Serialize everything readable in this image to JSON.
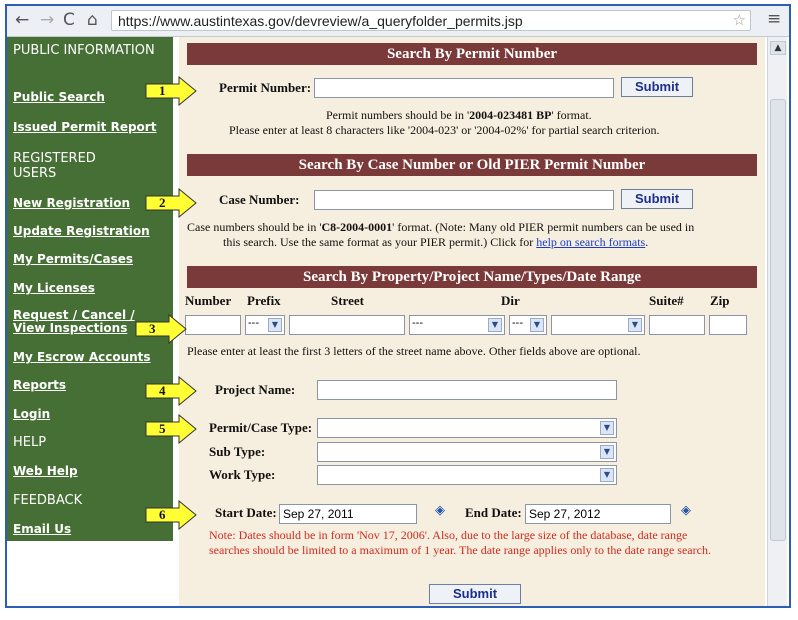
{
  "browser": {
    "url": "https://www.austintexas.gov/devreview/a_queryfolder_permits.jsp",
    "back_icon": "back-arrow-icon",
    "forward_icon": "forward-arrow-icon",
    "reload_icon": "reload-icon",
    "home_icon": "home-icon",
    "star_icon": "bookmark-star-icon",
    "menu_icon": "menu-icon"
  },
  "sidebar": {
    "headings": [
      "PUBLIC INFORMATION",
      "REGISTERED USERS",
      "HELP",
      "FEEDBACK"
    ],
    "links": {
      "public_search": "Public Search",
      "issued_permit_report": "Issued Permit Report",
      "new_registration": "New Registration",
      "update_registration": "Update Registration",
      "my_permits": "My Permits/Cases",
      "my_licenses": "My Licenses",
      "request_inspections_1": "Request / Cancel /",
      "request_inspections_2": "View Inspections",
      "my_escrow": "My Escrow Accounts",
      "reports": "Reports",
      "login": "Login",
      "web_help": "Web Help",
      "email_us": "Email Us"
    }
  },
  "permit_section": {
    "title": "Search By Permit Number",
    "label": "Permit Number:",
    "value": "",
    "submit": "Submit",
    "note_pre": "Permit numbers should be in '",
    "note_bold": "2004-023481 BP",
    "note_post": "' format.",
    "note2": "Please enter at least 8 characters like '2004-023' or '2004-02%' for partial search criterion."
  },
  "case_section": {
    "title": "Search By Case Number or Old PIER Permit Number",
    "label": "Case Number:",
    "value": "",
    "submit": "Submit",
    "note_pre": "Case numbers should be in '",
    "note_bold": "C8-2004-0001",
    "note_post": "' format. (Note: Many old PIER permit numbers can be used in",
    "note2": "this search. Use the same format as your PIER permit.) Click for",
    "help_link": "help on search formats",
    "note2_end": "."
  },
  "property_section": {
    "title": "Search By Property/Project Name/Types/Date Range",
    "columns": {
      "number": "Number",
      "prefix": "Prefix",
      "street": "Street",
      "dir": "Dir",
      "suite": "Suite#",
      "zip": "Zip"
    },
    "prefix_value": "---",
    "street_type_value": "---",
    "dir_value": "---",
    "note": "Please enter at least the first 3 letters of the street name above. Other fields above are optional.",
    "project_name_label": "Project Name:",
    "permit_type_label": "Permit/Case Type:",
    "sub_type_label": "Sub Type:",
    "work_type_label": "Work Type:",
    "start_date_label": "Start Date:",
    "start_date_value": "Sep 27, 2011",
    "end_date_label": "End Date:",
    "end_date_value": "Sep 27, 2012",
    "date_note1": "Note: Dates should be in form 'Nov 17, 2006'. Also, due to the large size of the database, date range",
    "date_note2": "searches should be limited to a maximum of 1 year. The date range applies only to the date range search.",
    "submit": "Submit",
    "calendar_icon": "calendar-icon"
  },
  "callouts": [
    "1",
    "2",
    "3",
    "4",
    "5",
    "6"
  ],
  "colors": {
    "sidebar_bg": "#466f35",
    "section_header_bg": "#7b3a3a",
    "main_bg": "#f6efdf",
    "callout_fill": "#ffff33",
    "note_red": "#d12a1e"
  }
}
